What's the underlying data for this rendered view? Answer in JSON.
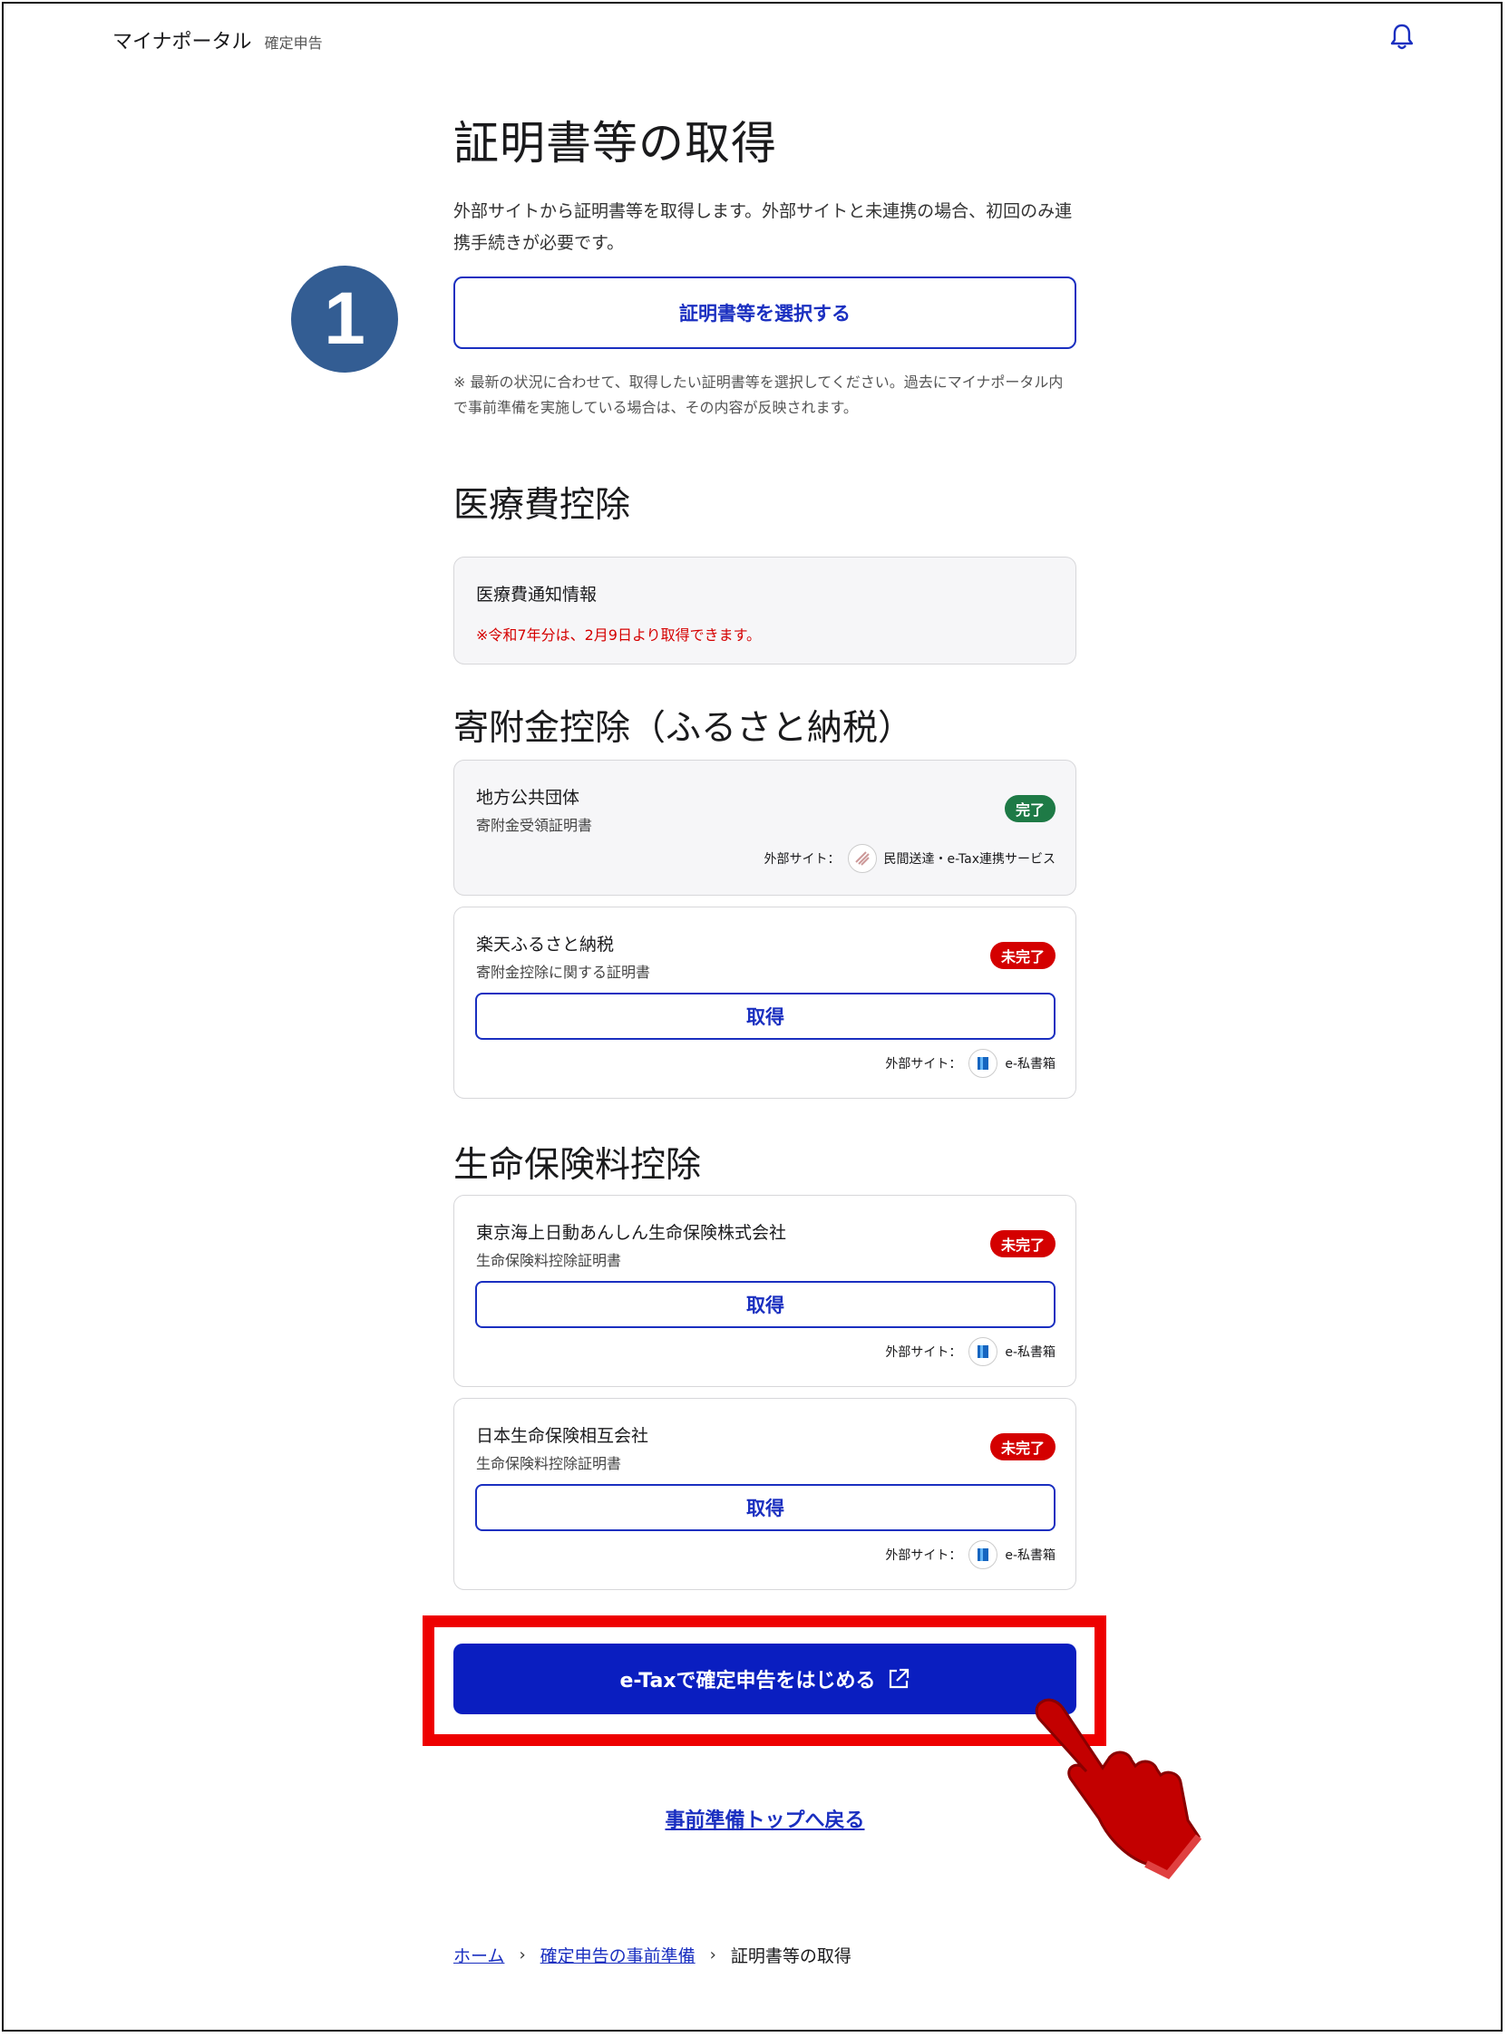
{
  "header": {
    "app_title": "マイナポータル",
    "app_sub": "確定申告"
  },
  "page": {
    "title": "証明書等の取得",
    "intro": "外部サイトから証明書等を取得します。外部サイトと未連携の場合、初回のみ連携手続きが必要です。",
    "step_number": "1",
    "select_button": "証明書等を選択する",
    "note": "※ 最新の状況に合わせて、取得したい証明書等を選択してください。過去にマイナポータル内で事前準備を実施している場合は、その内容が反映されます。"
  },
  "sections": {
    "medical": {
      "title": "医療費控除",
      "card": {
        "name": "医療費通知情報",
        "warning": "※令和7年分は、2月9日より取得できます。"
      }
    },
    "donation": {
      "title": "寄附金控除（ふるさと納税）",
      "cards": [
        {
          "name": "地方公共団体",
          "sub": "寄附金受領証明書",
          "status": "完了",
          "ext_label": "外部サイト：",
          "ext_name": "民間送達・e-Tax連携サービス"
        },
        {
          "name": "楽天ふるさと納税",
          "sub": "寄附金控除に関する証明書",
          "status": "未完了",
          "button": "取得",
          "ext_label": "外部サイト：",
          "ext_name": "e-私書箱"
        }
      ]
    },
    "insurance": {
      "title": "生命保険料控除",
      "cards": [
        {
          "name": "東京海上日動あんしん生命保険株式会社",
          "sub": "生命保険料控除証明書",
          "status": "未完了",
          "button": "取得",
          "ext_label": "外部サイト：",
          "ext_name": "e-私書箱"
        },
        {
          "name": "日本生命保険相互会社",
          "sub": "生命保険料控除証明書",
          "status": "未完了",
          "button": "取得",
          "ext_label": "外部サイト：",
          "ext_name": "e-私書箱"
        }
      ]
    }
  },
  "cta": {
    "label": "e-Taxで確定申告をはじめる",
    "icon": "external-link-icon"
  },
  "back_link": "事前準備トップへ戻る",
  "breadcrumb": [
    "ホーム",
    "確定申告の事前準備",
    "証明書等の取得"
  ],
  "colors": {
    "primary": "#1a2fc0",
    "cta": "#0a1ec0",
    "done": "#1e7a46",
    "todo": "#d40000",
    "highlight": "#ee0000",
    "step": "#335d93"
  }
}
